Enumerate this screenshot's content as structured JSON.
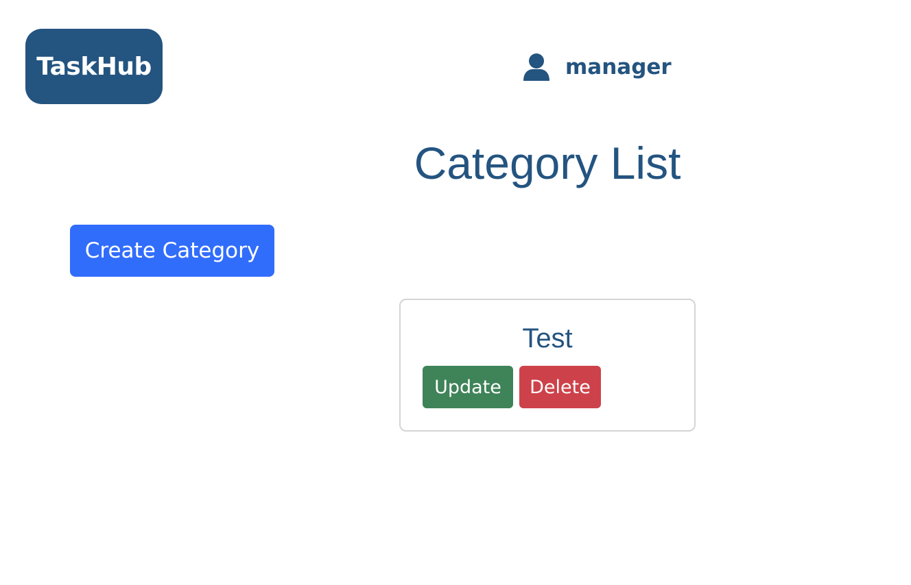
{
  "header": {
    "logo_text": "TaskHub",
    "username": "manager",
    "user_icon": "user-icon"
  },
  "main": {
    "title": "Category List",
    "create_button_label": "Create Category",
    "categories": [
      {
        "name": "Test",
        "update_label": "Update",
        "delete_label": "Delete"
      }
    ]
  },
  "colors": {
    "brand": "#245480",
    "primary": "#316dfb",
    "success": "#3f8359",
    "danger": "#cd424a",
    "card_border": "#d4d4d4"
  }
}
